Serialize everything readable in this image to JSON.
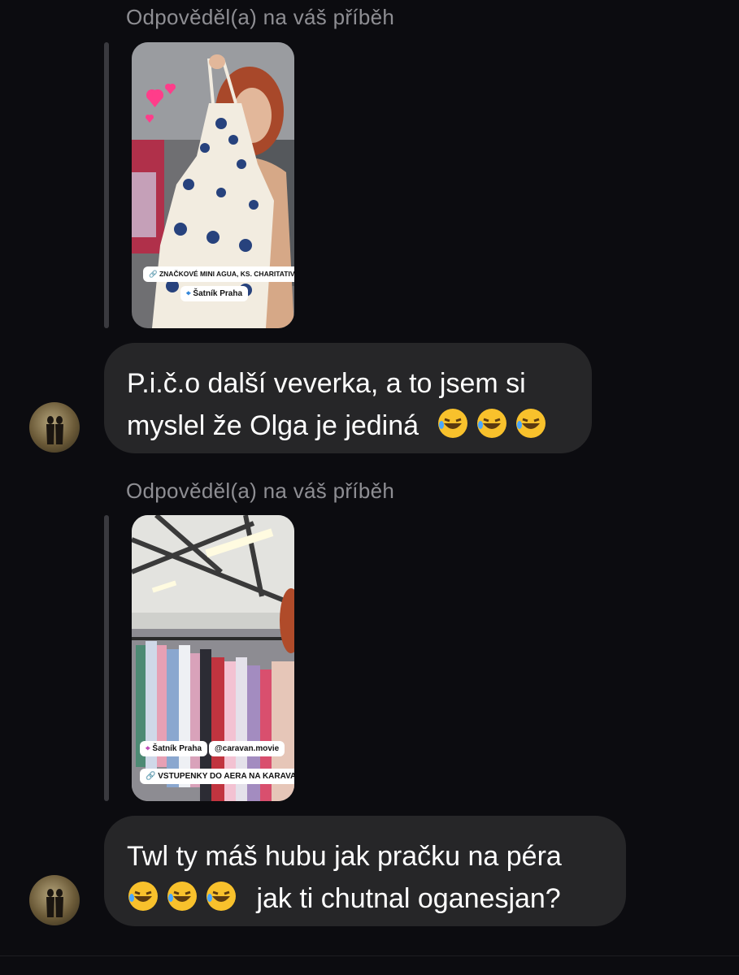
{
  "messages": [
    {
      "reply_label": "Odpověděl(a) na váš příběh",
      "story": {
        "link_sticker": "ZNAČKOVÉ MINI AGUA, KS. CHARITATIVNÍ DRAŽBA",
        "location_sticker": "Šatník Praha"
      },
      "text_line1": "P.i.č.o další veverka, a to jsem si",
      "text_line2": "myslel že Olga je jediná",
      "emoji": [
        "rolling-on-floor-laughing",
        "rolling-on-floor-laughing",
        "rolling-on-floor-laughing"
      ]
    },
    {
      "reply_label": "Odpověděl(a) na váš příběh",
      "story": {
        "location_sticker": "Šatník Praha",
        "mention_sticker": "@caravan.movie",
        "link_sticker": "VSTUPENKY DO AERA NA KARAVAN"
      },
      "text_line1": "Twl ty máš hubu jak pračku na péra",
      "text_line2": "jak ti chutnal oganesjan?",
      "emoji": [
        "rolling-on-floor-laughing",
        "rolling-on-floor-laughing",
        "rolling-on-floor-laughing"
      ]
    }
  ],
  "colors": {
    "background": "#0c0c10",
    "bubble": "#262628",
    "label": "#8e8e93",
    "reply_bar": "#3a3a3f"
  }
}
